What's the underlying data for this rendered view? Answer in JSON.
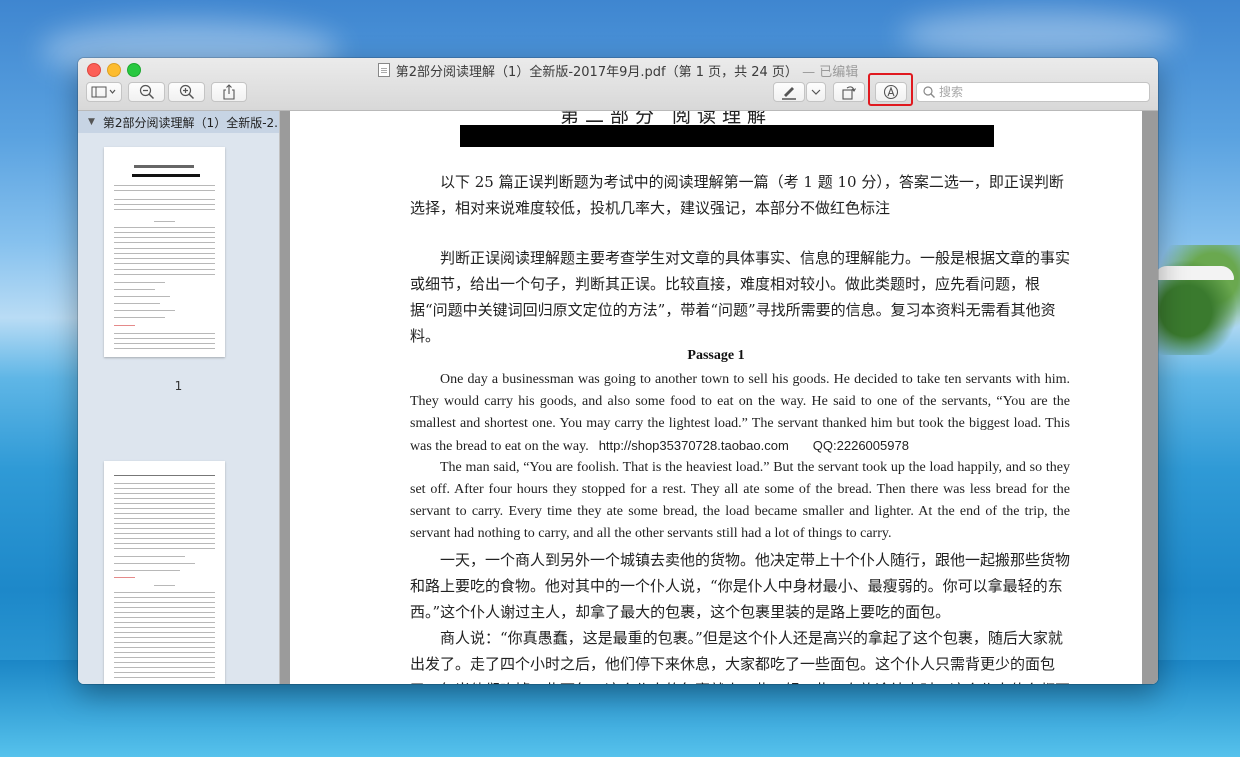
{
  "window": {
    "title": "第2部分阅读理解（1）全新版-2017年9月.pdf（第 1 页，共 24 页）",
    "edited": " — 已编辑"
  },
  "toolbar": {
    "search_placeholder": "搜索",
    "icons": {
      "sidebar": "sidebar-toggle-icon",
      "zoom_out": "zoom-out-icon",
      "zoom_in": "zoom-in-icon",
      "share": "share-icon",
      "pen": "pen-icon",
      "rotate": "rotate-icon",
      "markup": "markup-icon"
    },
    "highlight_color": "#e0191f"
  },
  "sidebar": {
    "doc_name": "第2部分阅读理解（1）全新版-2...",
    "page_label": "1"
  },
  "document": {
    "intro": "以下 25 篇正误判断题为考试中的阅读理解第一篇（考 1 题 10 分），答案二选一，即正误判断选择，相对来说难度较低，投机几率大，建议强记，本部分不做红色标注",
    "guide": "判断正误阅读理解题主要考查学生对文章的具体事实、信息的理解能力。一般是根据文章的事实或细节，给出一个句子，判断其正误。比较直接，难度相对较小。做此类题时，应先看问题，根据“问题中关键词回归原文定位的方法”，带着“问题”寻找所需要的信息。复习本资料无需看其他资料。",
    "passage_title": "Passage 1",
    "en_para1": "One day a businessman was going to another town to sell his goods. He decided to take ten servants with him. They would carry his goods, and also some food to eat on the way. He said to one of the servants, “You are the smallest and shortest one. You may carry the lightest load.” The servant thanked him but took the biggest load. This was the bread to eat on the way.",
    "watermark_url": "http://shop35370728.taobao.com",
    "watermark_qq": "QQ:2226005978",
    "en_para2": "The man said, “You are foolish. That is the heaviest load.” But the servant took up the load happily, and so they set off. After four hours they stopped for a rest. They all ate some of the bread. Then there was less bread for the servant to carry. Every time they ate some bread, the load became smaller and lighter. At the end of the trip, the servant had nothing to carry, and all the other servants still had a lot of things to carry.",
    "cn_para1": "一天，一个商人到另外一个城镇去卖他的货物。他决定带上十个仆人随行，跟他一起搬那些货物和路上要吃的食物。他对其中的一个仆人说，“你是仆人中身材最小、最瘦弱的。你可以拿最轻的东西。”这个仆人谢过主人，却拿了最大的包裹，这个包裹里装的是路上要吃的面包。",
    "cn_para2": "商人说：“你真愚蠢，这是最重的包裹。”但是这个仆人还是高兴的拿起了这个包裹，随后大家就出发了。走了四个小时之后，他们停下来休息，大家都吃了一些面包。这个仆人只需背更少的面包了。每当他们吃掉一些面包，这个仆人的包裹就小一些，轻一些。在旅途结束时，这个仆人什么都不用拿"
  }
}
